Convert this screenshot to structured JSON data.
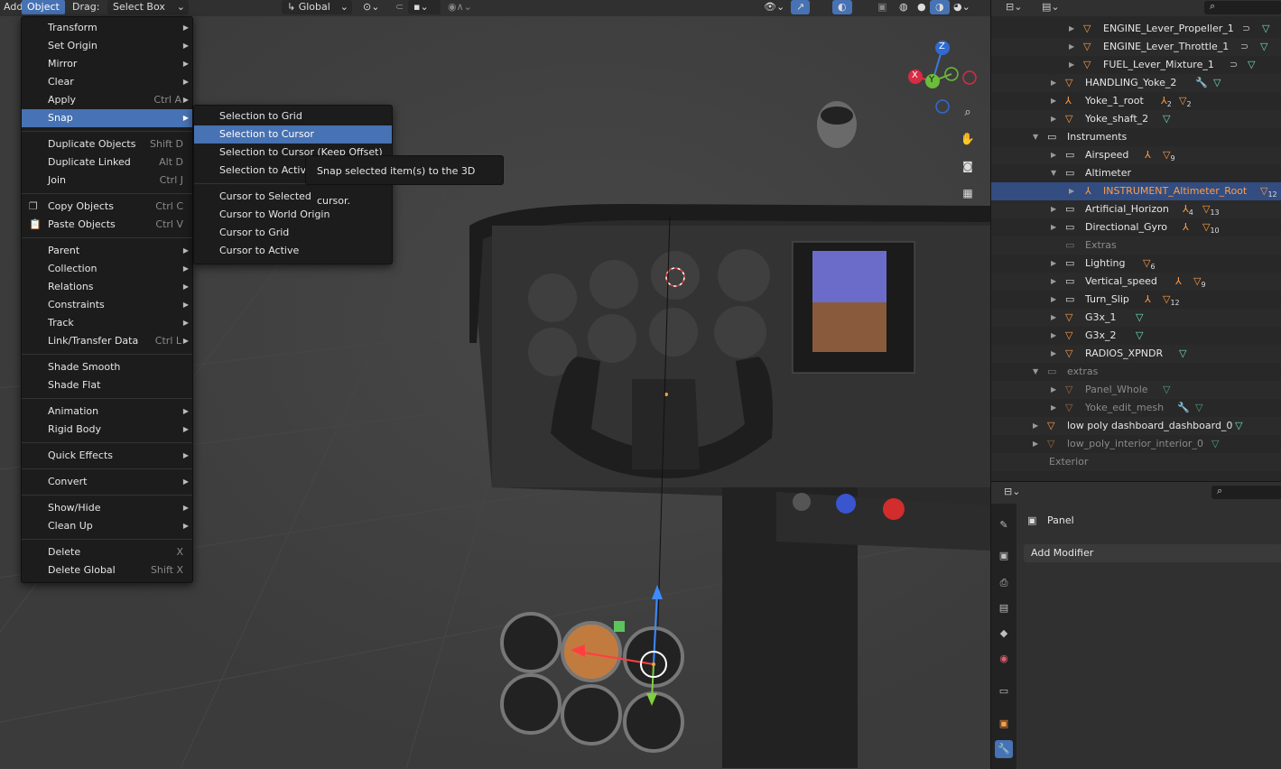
{
  "header": {
    "add": "Add",
    "object": "Object",
    "drag_label": "Drag:",
    "select_mode": "Select Box",
    "orientation": "Global"
  },
  "object_menu": {
    "items": [
      {
        "label": "Transform",
        "shortcut": "",
        "submenu": true
      },
      {
        "label": "Set Origin",
        "shortcut": "",
        "submenu": true
      },
      {
        "label": "Mirror",
        "shortcut": "",
        "submenu": true
      },
      {
        "label": "Clear",
        "shortcut": "",
        "submenu": true
      },
      {
        "label": "Apply",
        "shortcut": "Ctrl A",
        "submenu": true
      },
      {
        "label": "Snap",
        "shortcut": "",
        "submenu": true
      },
      {
        "label": "Duplicate Objects",
        "shortcut": "Shift D"
      },
      {
        "label": "Duplicate Linked",
        "shortcut": "Alt D"
      },
      {
        "label": "Join",
        "shortcut": "Ctrl J"
      },
      {
        "label": "Copy Objects",
        "shortcut": "Ctrl C"
      },
      {
        "label": "Paste Objects",
        "shortcut": "Ctrl V"
      },
      {
        "label": "Parent",
        "submenu": true
      },
      {
        "label": "Collection",
        "submenu": true
      },
      {
        "label": "Relations",
        "submenu": true
      },
      {
        "label": "Constraints",
        "submenu": true
      },
      {
        "label": "Track",
        "submenu": true
      },
      {
        "label": "Link/Transfer Data",
        "shortcut": "Ctrl L",
        "submenu": true
      },
      {
        "label": "Shade Smooth"
      },
      {
        "label": "Shade Flat"
      },
      {
        "label": "Animation",
        "submenu": true
      },
      {
        "label": "Rigid Body",
        "submenu": true
      },
      {
        "label": "Quick Effects",
        "submenu": true
      },
      {
        "label": "Convert",
        "submenu": true
      },
      {
        "label": "Show/Hide",
        "submenu": true
      },
      {
        "label": "Clean Up",
        "submenu": true
      },
      {
        "label": "Delete",
        "shortcut": "X"
      },
      {
        "label": "Delete Global",
        "shortcut": "Shift X"
      }
    ]
  },
  "snap_menu": {
    "items": [
      "Selection to Grid",
      "Selection to Cursor",
      "Selection to Cursor (Keep Offset)",
      "Selection to Active",
      "Cursor to Selected",
      "Cursor to World Origin",
      "Cursor to Grid",
      "Cursor to Active"
    ]
  },
  "tooltip": "Snap selected item(s) to the 3D cursor.",
  "gizmo": {
    "z": "Z",
    "y": "Y",
    "x": "X"
  },
  "outliner": {
    "rows": [
      {
        "label": "ENGINE_Lever_Propeller_1"
      },
      {
        "label": "ENGINE_Lever_Throttle_1"
      },
      {
        "label": "FUEL_Lever_Mixture_1"
      },
      {
        "label": "HANDLING_Yoke_2"
      },
      {
        "label": "Yoke_1_root",
        "count": "2",
        "count2": "2"
      },
      {
        "label": "Yoke_shaft_2"
      },
      {
        "label": "Instruments"
      },
      {
        "label": "Airspeed",
        "count": "9"
      },
      {
        "label": "Altimeter"
      },
      {
        "label": "INSTRUMENT_Altimeter_Root",
        "count": "12"
      },
      {
        "label": "Artificial_Horizon",
        "count": "4",
        "count2": "13"
      },
      {
        "label": "Directional_Gyro",
        "count": "10"
      },
      {
        "label": "Extras"
      },
      {
        "label": "Lighting",
        "count": "6"
      },
      {
        "label": "Vertical_speed",
        "count": "9"
      },
      {
        "label": "Turn_Slip",
        "count": "12"
      },
      {
        "label": "G3x_1"
      },
      {
        "label": "G3x_2"
      },
      {
        "label": "RADIOS_XPNDR"
      },
      {
        "label": "extras"
      },
      {
        "label": "Panel_Whole"
      },
      {
        "label": "Yoke_edit_mesh"
      },
      {
        "label": "low poly dashboard_dashboard_0"
      },
      {
        "label": "low_poly_interior_interior_0"
      },
      {
        "label": "Exterior"
      }
    ]
  },
  "properties": {
    "object_name": "Panel",
    "add_modifier": "Add Modifier"
  }
}
